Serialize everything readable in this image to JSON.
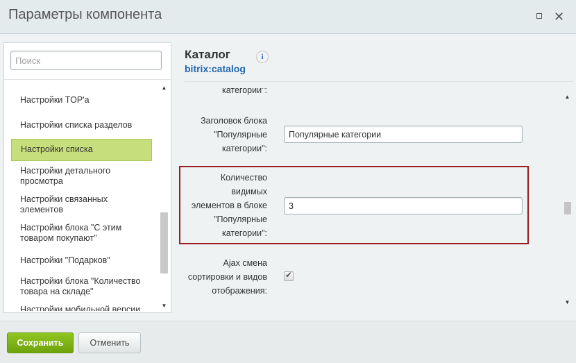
{
  "window": {
    "title": "Параметры компонента",
    "maximize_label": "maximize",
    "close_glyph": "✕"
  },
  "sidebar": {
    "search_placeholder": "Поиск",
    "items": [
      {
        "label": "Настройки TOP'а"
      },
      {
        "label": "Настройки списка разделов"
      },
      {
        "label": "Настройки списка",
        "active": true
      },
      {
        "label": "Настройки детального просмотра"
      },
      {
        "label": "Настройки связанных элементов"
      },
      {
        "label": "Настройки блока \"С этим товаром покупают\""
      },
      {
        "label": "Настройки \"Подарков\""
      },
      {
        "label": "Настройки блока \"Количество товара на складе\""
      },
      {
        "label": "Настройки мобильной версии"
      }
    ],
    "active_color": "#c7de7c"
  },
  "main": {
    "heading": "Каталог",
    "subheading": "bitrix:catalog",
    "info_glyph": "i",
    "fields": {
      "cut_label": "категории\":",
      "block_title_label_1": "Заголовок блока",
      "block_title_label_2": "\"Популярные",
      "block_title_label_3": "категории\":",
      "block_title_value": "Популярные категории",
      "count_label_1": "Количество",
      "count_label_2": "видимых",
      "count_label_3": "элементов в блоке",
      "count_label_4": "\"Популярные",
      "count_label_5": "категории\":",
      "count_value": "3",
      "ajax_label_1": "Ajax смена",
      "ajax_label_2": "сортировки и видов",
      "ajax_label_3": "отображения:",
      "ajax_checked": true
    },
    "highlight_color": "#9b1b1f"
  },
  "footer": {
    "save_label": "Сохранить",
    "cancel_label": "Отменить"
  },
  "colors": {
    "accent_green": "#7cb516",
    "link_blue": "#2067b0"
  }
}
